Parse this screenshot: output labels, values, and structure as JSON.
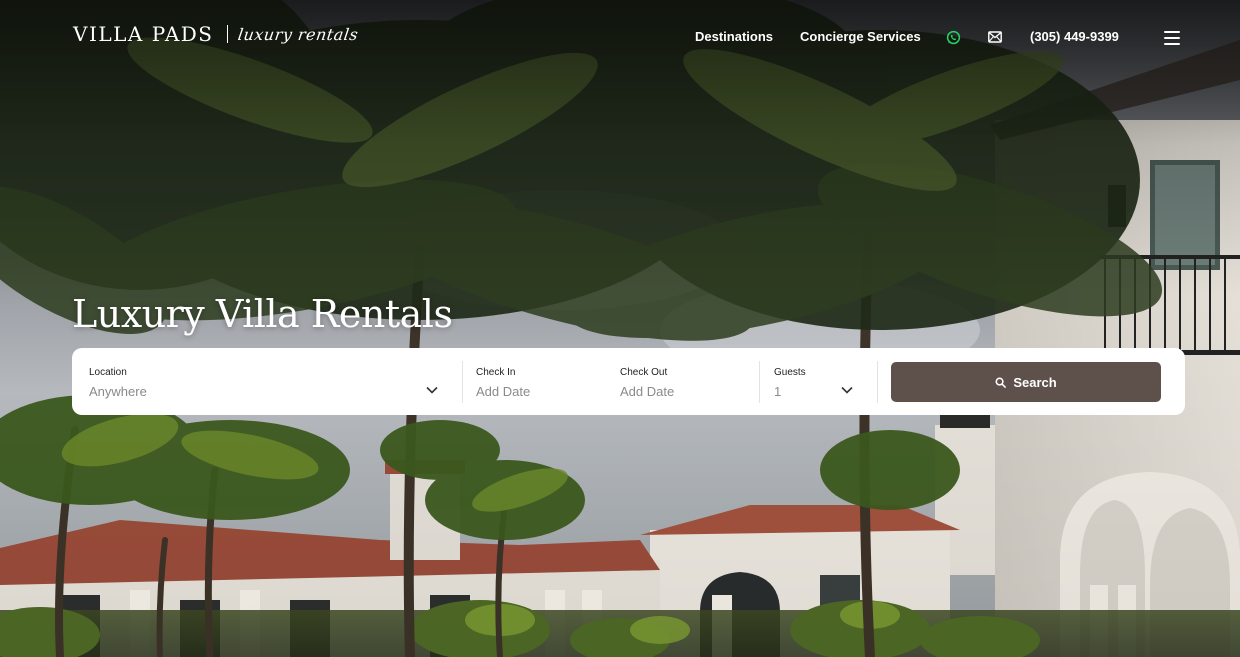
{
  "logo": {
    "main": "VILLA PADS",
    "script": "luxury rentals"
  },
  "nav": {
    "destinations": "Destinations",
    "concierge": "Concierge Services",
    "phone": "(305) 449-9399",
    "icons": [
      "whatsapp-icon",
      "mail-icon",
      "hamburger-menu-icon"
    ]
  },
  "hero": {
    "title": "Luxury Villa Rentals"
  },
  "search": {
    "location": {
      "label": "Location",
      "value": "Anywhere"
    },
    "check_in": {
      "label": "Check In",
      "placeholder": "Add Date"
    },
    "check_out": {
      "label": "Check Out",
      "placeholder": "Add Date"
    },
    "guests": {
      "label": "Guests",
      "value": "1"
    },
    "button_label": "Search"
  },
  "colors": {
    "search_button": "#5e514c",
    "whatsapp": "#25d366",
    "panel": "#ffffff"
  }
}
